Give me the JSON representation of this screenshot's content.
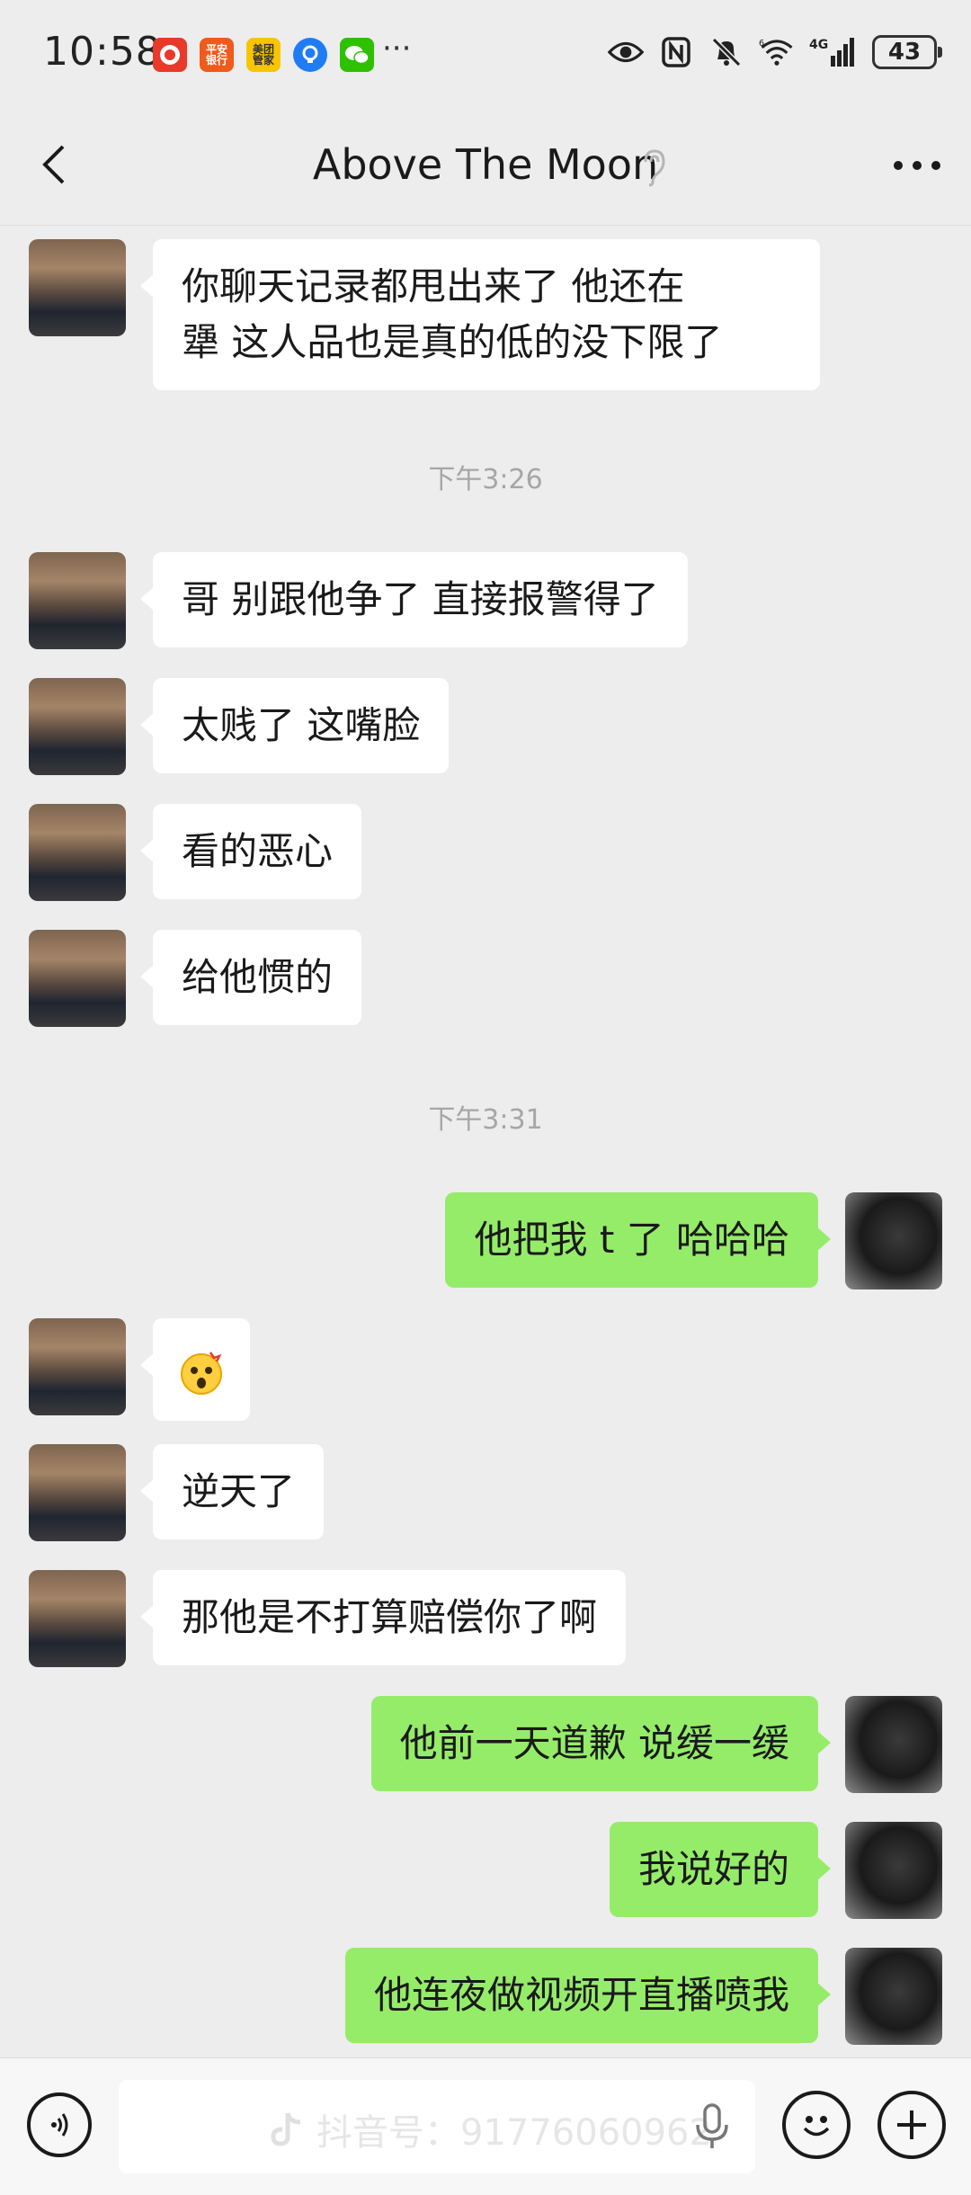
{
  "status_bar": {
    "time": "10:58",
    "apps": [
      {
        "name": "red-app-icon",
        "label": "",
        "color": "#e8392b"
      },
      {
        "name": "pingan-bank-icon",
        "label": "平安\n银行",
        "color": "#f05a1a"
      },
      {
        "name": "meituan-icon",
        "label": "美团\n管家",
        "color": "#f7c600"
      },
      {
        "name": "lightbulb-app-icon",
        "label": "",
        "color": "#1f7cf5"
      },
      {
        "name": "wechat-icon",
        "label": "",
        "color": "#2dc100"
      }
    ],
    "more_dots": "···",
    "signal_label": "4G",
    "wifi_label": "6",
    "battery": "43"
  },
  "nav": {
    "title": "Above The Moon"
  },
  "messages": [
    {
      "type": "in",
      "text": "你聊天记录都甩出来了  他还在\n犟   这人品也是真的低的没下限了"
    },
    {
      "type": "time",
      "text": "下午3:26"
    },
    {
      "type": "in",
      "text": "哥  别跟他争了  直接报警得了"
    },
    {
      "type": "in",
      "text": "太贱了 这嘴脸"
    },
    {
      "type": "in",
      "text": "看的恶心"
    },
    {
      "type": "in",
      "text": "给他惯的"
    },
    {
      "type": "time",
      "text": "下午3:31"
    },
    {
      "type": "out",
      "text": "他把我 t 了 哈哈哈"
    },
    {
      "type": "in",
      "text": "😲"
    },
    {
      "type": "in",
      "text": "逆天了"
    },
    {
      "type": "in",
      "text": "那他是不打算赔偿你了啊"
    },
    {
      "type": "out",
      "text": "他前一天道歉 说缓一缓"
    },
    {
      "type": "out",
      "text": "我说好的"
    },
    {
      "type": "out",
      "text": "他连夜做视频开直播喷我"
    }
  ],
  "input": {
    "value": "",
    "watermark": "抖音号：91776060962"
  },
  "colors": {
    "bubble_out": "#95ec69",
    "bubble_in": "#ffffff",
    "background": "#ededed"
  }
}
